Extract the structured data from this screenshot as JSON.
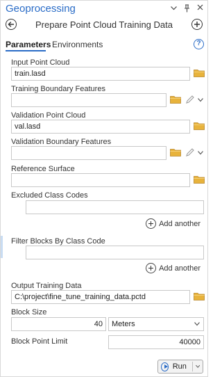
{
  "pane": {
    "title": "Geoprocessing",
    "title_icons": [
      "chevron-down-icon",
      "pin-icon",
      "close-icon"
    ]
  },
  "tool": {
    "title": "Prepare Point Cloud Training Data",
    "back_icon": "back-arrow-icon",
    "add_icon": "add-icon"
  },
  "tabs": [
    {
      "label": "Parameters",
      "active": true
    },
    {
      "label": "Environments",
      "active": false
    }
  ],
  "help_symbol": "?",
  "params": {
    "input_point_cloud": {
      "label": "Input Point Cloud",
      "value": "train.lasd"
    },
    "training_boundary": {
      "label": "Training Boundary Features",
      "value": ""
    },
    "validation_point_cloud": {
      "label": "Validation Point Cloud",
      "value": "val.lasd"
    },
    "validation_boundary": {
      "label": "Validation Boundary Features",
      "value": ""
    },
    "reference_surface": {
      "label": "Reference Surface",
      "value": ""
    },
    "excluded_class_codes": {
      "label": "Excluded Class Codes",
      "value": "",
      "add_label": "Add another"
    },
    "filter_blocks": {
      "label": "Filter Blocks By Class Code",
      "value": "",
      "add_label": "Add another"
    },
    "output_training_data": {
      "label": "Output Training Data",
      "value": "C:\\project\\fine_tune_training_data.pctd"
    },
    "block_size": {
      "label": "Block Size",
      "value": "40",
      "unit": "Meters"
    },
    "block_point_limit": {
      "label": "Block Point Limit",
      "value": "40000"
    }
  },
  "run_button": {
    "label": "Run"
  },
  "colors": {
    "accent": "#2a6cc7",
    "folder": "#e8b33c",
    "border": "#c8c8c8"
  }
}
